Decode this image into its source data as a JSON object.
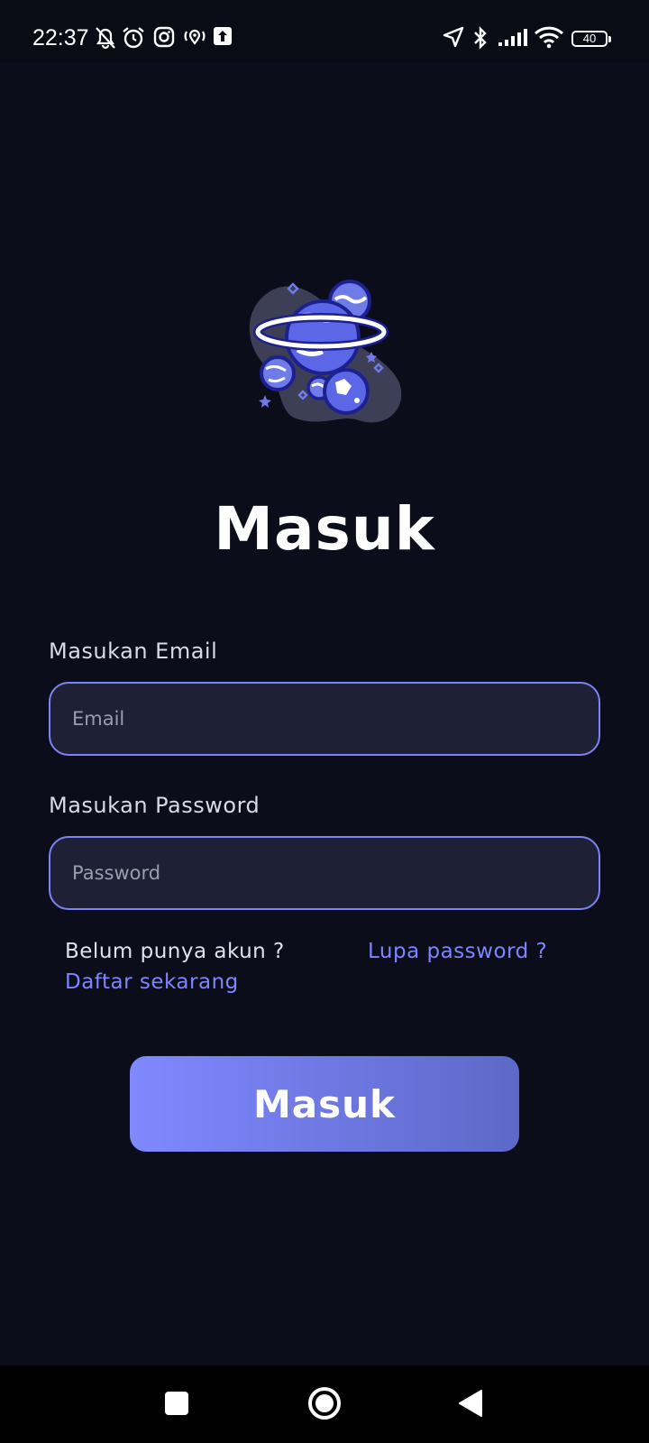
{
  "status_bar": {
    "time": "22:37",
    "left_icons": [
      "bell-off-icon",
      "alarm-icon",
      "instagram-icon",
      "location-tracking-icon",
      "upload-icon"
    ],
    "right_icons": [
      "navigation-icon",
      "bluetooth-icon",
      "signal-icon",
      "wifi-icon"
    ],
    "battery": "40"
  },
  "page": {
    "title": "Masuk",
    "logo": "planet-icon",
    "accent": "#7b83f5"
  },
  "form": {
    "email_label": "Masukan Email",
    "email_placeholder": "Email",
    "email_value": "",
    "password_label": "Masukan Password",
    "password_placeholder": "Password",
    "password_value": ""
  },
  "links": {
    "no_account": "Belum punya akun ?",
    "register": "Daftar sekarang",
    "forgot": "Lupa password ?"
  },
  "submit": {
    "label": "Masuk"
  },
  "nav_bar": {
    "icons": [
      "recents-square-icon",
      "home-circle-icon",
      "back-triangle-icon"
    ]
  }
}
